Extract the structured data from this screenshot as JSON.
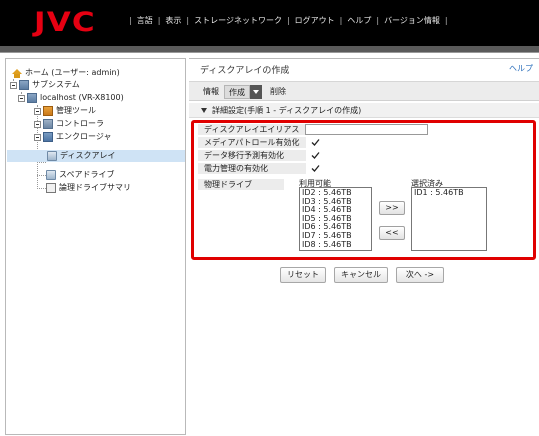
{
  "header": {
    "logo": "JVC",
    "nav": [
      "言語",
      "表示",
      "ストレージネットワーク",
      "ログアウト",
      "ヘルプ",
      "バージョン情報"
    ],
    "separator": "|"
  },
  "sidebar": {
    "items": [
      {
        "label": "ホーム (ユーザー: admin)",
        "icon": "home-icon"
      },
      {
        "label": "サブシステム",
        "icon": "server-icon"
      },
      {
        "label": "localhost (VR-X8100)",
        "icon": "server-icon"
      },
      {
        "label": "管理ツール",
        "icon": "tools-icon"
      },
      {
        "label": "コントローラ",
        "icon": "controller-icon"
      },
      {
        "label": "エンクロージャ",
        "icon": "enclosure-icon"
      },
      {
        "label": "ディスクアレイ",
        "icon": "disk-array-icon"
      },
      {
        "label": "スペアドライブ",
        "icon": "spare-drive-icon"
      },
      {
        "label": "論理ドライブサマリ",
        "icon": "logical-drive-icon"
      }
    ]
  },
  "main": {
    "title": "ディスクアレイの作成",
    "help": "ヘルプ",
    "tabs": [
      "情報",
      "作成",
      "削除"
    ],
    "section_title": "詳細設定(手順 1 - ディスクアレイの作成)",
    "fields": {
      "alias_label": "ディスクアレイエイリアス",
      "alias_value": "",
      "media_patrol_label": "メディアパトロール有効化",
      "media_patrol_checked": true,
      "pdm_label": "データ移行予測有効化",
      "pdm_checked": true,
      "power_label": "電力管理の有効化",
      "power_checked": true
    },
    "physical_drives": {
      "label": "物理ドライブ",
      "available_label": "利用可能",
      "selected_label": "選択済み",
      "available": [
        "ID2 : 5.46TB",
        "ID3 : 5.46TB",
        "ID4 : 5.46TB",
        "ID5 : 5.46TB",
        "ID6 : 5.46TB",
        "ID7 : 5.46TB",
        "ID8 : 5.46TB"
      ],
      "selected": [
        "ID1 : 5.46TB"
      ],
      "add_button": ">>",
      "remove_button": "<<"
    },
    "buttons": {
      "reset": "リセット",
      "cancel": "キャンセル",
      "next": "次へ ->"
    }
  },
  "colors": {
    "accent_red": "#e00000",
    "logo_red": "#e60012",
    "header_bg": "#000000",
    "selected_bg": "#cfe3f5",
    "link_blue": "#2a6ebb"
  }
}
